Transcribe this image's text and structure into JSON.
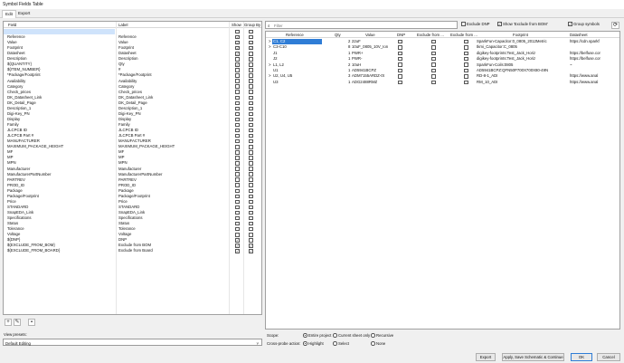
{
  "window": {
    "title": "Symbol Fields Table"
  },
  "tabs": [
    "Edit",
    "Export"
  ],
  "left_panel": {
    "headers": {
      "field": "Field",
      "label": "Label",
      "show": "Show",
      "group_by": "Group By"
    },
    "rows": [
      {
        "field": "",
        "label": "",
        "show": false,
        "group": false,
        "selected": true
      },
      {
        "field": "Reference",
        "label": "Reference",
        "show": true,
        "group": false
      },
      {
        "field": "Value",
        "label": "Value",
        "show": true,
        "group": true
      },
      {
        "field": "Footprint",
        "label": "Footprint",
        "show": true,
        "group": true
      },
      {
        "field": "Datasheet",
        "label": "Datasheet",
        "show": true,
        "group": false
      },
      {
        "field": "Description",
        "label": "Description",
        "show": false,
        "group": false
      },
      {
        "field": "${QUANTITY}",
        "label": "Qty",
        "show": true,
        "group": false
      },
      {
        "field": "${ITEM_NUMBER}",
        "label": "#",
        "show": false,
        "group": false
      },
      {
        "field": "*Package/Footprint",
        "label": "*Package/Footprint",
        "show": false,
        "group": false
      },
      {
        "field": "Availability",
        "label": "Availability",
        "show": false,
        "group": false
      },
      {
        "field": "Category",
        "label": "Category",
        "show": false,
        "group": false
      },
      {
        "field": "Check_prices",
        "label": "Check_prices",
        "show": false,
        "group": false
      },
      {
        "field": "DK_Datasheet_Link",
        "label": "DK_Datasheet_Link",
        "show": false,
        "group": false
      },
      {
        "field": "DK_Detail_Page",
        "label": "DK_Detail_Page",
        "show": false,
        "group": false
      },
      {
        "field": "Description_1",
        "label": "Description_1",
        "show": false,
        "group": false
      },
      {
        "field": "Digi-Key_PN",
        "label": "Digi-Key_PN",
        "show": false,
        "group": false
      },
      {
        "field": "Display",
        "label": "Display",
        "show": false,
        "group": false
      },
      {
        "field": "Family",
        "label": "Family",
        "show": false,
        "group": false
      },
      {
        "field": "JLCPCB ID",
        "label": "JLCPCB ID",
        "show": false,
        "group": false
      },
      {
        "field": "JLCPCB Part #",
        "label": "JLCPCB Part #",
        "show": false,
        "group": false
      },
      {
        "field": "MANUFACTURER",
        "label": "MANUFACTURER",
        "show": false,
        "group": false
      },
      {
        "field": "MAXIMUM_PACKAGE_HEIGHT",
        "label": "MAXIMUM_PACKAGE_HEIGHT",
        "show": false,
        "group": false
      },
      {
        "field": "MF",
        "label": "MF",
        "show": false,
        "group": false
      },
      {
        "field": "MP",
        "label": "MP",
        "show": false,
        "group": false
      },
      {
        "field": "MPN",
        "label": "MPN",
        "show": false,
        "group": false
      },
      {
        "field": "Manufacturer",
        "label": "Manufacturer",
        "show": false,
        "group": false
      },
      {
        "field": "ManufacturerPartNumber",
        "label": "ManufacturerPartNumber",
        "show": false,
        "group": false
      },
      {
        "field": "PARTREV",
        "label": "PARTREV",
        "show": false,
        "group": false
      },
      {
        "field": "PROD_ID",
        "label": "PROD_ID",
        "show": false,
        "group": false
      },
      {
        "field": "Package",
        "label": "Package",
        "show": false,
        "group": false
      },
      {
        "field": "Package/Footprint",
        "label": "Package/Footprint",
        "show": false,
        "group": false
      },
      {
        "field": "Price",
        "label": "Price",
        "show": false,
        "group": false
      },
      {
        "field": "STANDARD",
        "label": "STANDARD",
        "show": false,
        "group": false
      },
      {
        "field": "SnapEDA_Link",
        "label": "SnapEDA_Link",
        "show": false,
        "group": false
      },
      {
        "field": "Specifications",
        "label": "Specifications",
        "show": false,
        "group": false
      },
      {
        "field": "Status",
        "label": "Status",
        "show": false,
        "group": false
      },
      {
        "field": "Tolerance",
        "label": "Tolerance",
        "show": false,
        "group": false
      },
      {
        "field": "Voltage",
        "label": "Voltage",
        "show": false,
        "group": false
      },
      {
        "field": "${DNP}",
        "label": "DNP",
        "show": true,
        "group": false
      },
      {
        "field": "${EXCLUDE_FROM_BOM}",
        "label": "Exclude from BOM",
        "show": true,
        "group": true
      },
      {
        "field": "${EXCLUDE_FROM_BOARD}",
        "label": "Exclude from Board",
        "show": true,
        "group": true
      }
    ],
    "toolbar_icons": [
      "plus-icon",
      "pencil-icon",
      "trash-icon"
    ],
    "view_preset_label": "View presets:",
    "view_preset_value": "Default Editing",
    "dropdown_arrow": "˅"
  },
  "right_panel": {
    "filter_placeholder": "Filter",
    "search_glyph": "⌕",
    "options": {
      "exclude_dnp": "Exclude DNP",
      "show_excluded": "Show 'Exclude from BOM'",
      "group_symbols": "Group symbols"
    },
    "refresh_glyph": "⟳",
    "headers": [
      "Reference",
      "Qty",
      "Value",
      "DNP",
      "Exclude from ...",
      "Exclude from ...",
      "Footprint",
      "Datasheet"
    ],
    "rows": [
      {
        "expander": ">",
        "reference": "C1, C2",
        "qty": "2",
        "value": "22uF",
        "footprint": "SparkFun-Capacitor:0_0805_2012Metric",
        "datasheet": "https://cdn.sparkf",
        "selected": true
      },
      {
        "expander": ">",
        "reference": "C3-C10",
        "qty": "8",
        "value": "10uF_0805_10V_Ion",
        "footprint": "tkmi_Capacitor:C_0805",
        "datasheet": ""
      },
      {
        "expander": "",
        "reference": "J1",
        "qty": "1",
        "value": "PWR+",
        "footprint": "digikey-footprints:Test_Jack_Horiz",
        "datasheet": "https://belfuse.cor"
      },
      {
        "expander": "",
        "reference": "J2",
        "qty": "1",
        "value": "PWR-",
        "footprint": "digikey-footprints:Test_Jack_Horiz",
        "datasheet": "https://belfuse.cor"
      },
      {
        "expander": ">",
        "reference": "L1, L2",
        "qty": "2",
        "value": "10uH",
        "footprint": "SparkFun-Coils:0805",
        "datasheet": "~"
      },
      {
        "expander": "",
        "reference": "U1",
        "qty": "1",
        "value": "AD5941BCPZ",
        "footprint": "AD5941BCPZ:QFN50P700X700X80-49N",
        "datasheet": ""
      },
      {
        "expander": ">",
        "reference": "U2, U4, U5",
        "qty": "3",
        "value": "ADM7155ARDZ-0t",
        "footprint": "RD-8-1_ADI",
        "datasheet": "https://www.anal"
      },
      {
        "expander": "",
        "reference": "U3",
        "qty": "1",
        "value": "ADG2488RMZ",
        "footprint": "RM_10_ADI",
        "datasheet": "https://www.anal"
      }
    ]
  },
  "scope": {
    "label": "Scope:",
    "options": [
      "Entire project",
      "Current sheet only",
      "Recursive"
    ],
    "selected": "Entire project"
  },
  "cross_probe": {
    "label": "Cross-probe action:",
    "options": [
      "Highlight",
      "Select",
      "None"
    ],
    "selected": "Highlight"
  },
  "buttons": {
    "export": "Export",
    "apply_save": "Apply, Save Schematic & Continue",
    "ok": "OK",
    "cancel": "Cancel"
  }
}
